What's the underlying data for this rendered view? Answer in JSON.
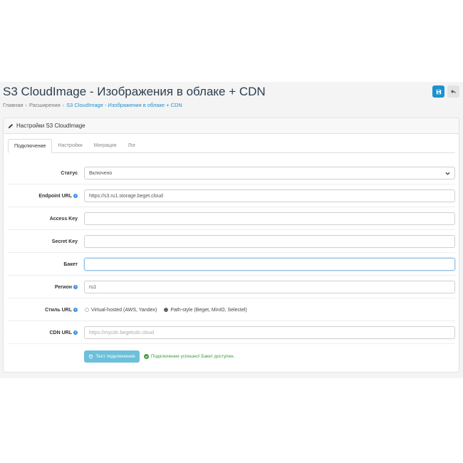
{
  "header": {
    "title": "S3 CloudImage - Изображения в облаке + CDN",
    "save_icon": "save-icon",
    "back_icon": "reply-icon"
  },
  "breadcrumb": [
    "Главная",
    "Расширения",
    "S3 CloudImage - Изображения в облаке + CDN"
  ],
  "panel": {
    "heading": "Настройки S3 CloudImage",
    "heading_icon": "pencil-icon"
  },
  "tabs": [
    "Подключение",
    "Настройки",
    "Миграция",
    "Лог"
  ],
  "form": {
    "status": {
      "label": "Статус",
      "value": "Включено"
    },
    "endpoint": {
      "label": "Endpoint URL",
      "value": "https://s3.ru1.storage.beget.cloud"
    },
    "access_key": {
      "label": "Access Key",
      "value": ""
    },
    "secret_key": {
      "label": "Secret Key",
      "value": ""
    },
    "bucket": {
      "label": "Бакет",
      "value": ""
    },
    "region": {
      "label": "Регион",
      "value": "ru1"
    },
    "url_style": {
      "label": "Стиль URL",
      "options": [
        "Virtual-hosted (AWS, Yandex)",
        "Path-style (Beget, MinIO, Selectel)"
      ],
      "selected": "Path-style (Beget, MinIO, Selectel)"
    },
    "cdn_url": {
      "label": "CDN URL",
      "placeholder": "https://mycdn.begetcdn.cloud"
    }
  },
  "test_button": {
    "label": "Тест подключения",
    "icon": "plug-icon"
  },
  "test_result": {
    "text": "Подключение успешно! Бакет доступен.",
    "icon": "check-circle-icon"
  },
  "colors": {
    "primary": "#1e91cf",
    "info": "#6cc0da",
    "success": "#3c9a3c",
    "help": "#3a8dde"
  }
}
